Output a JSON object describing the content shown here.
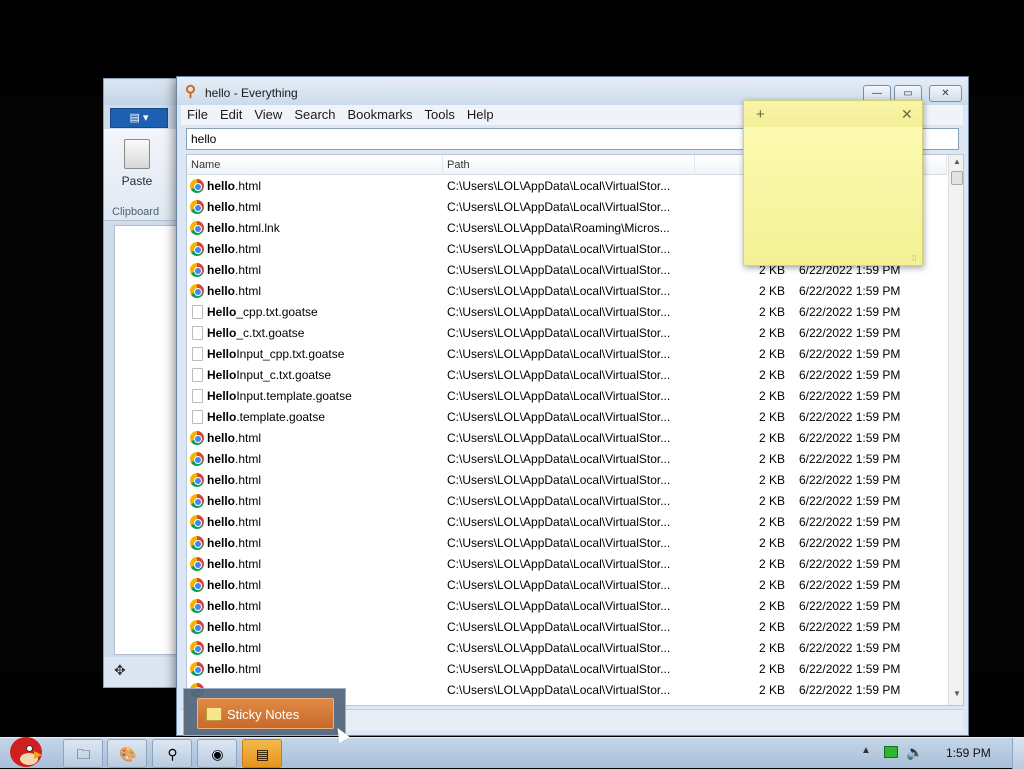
{
  "paint": {
    "tab_glyph": "▤ ▾",
    "paste_label": "Paste",
    "clipboard_label": "Clipboard",
    "move_glyph": "✥"
  },
  "everything": {
    "title": "hello - Everything",
    "app_icon_glyph": "⚲",
    "window_buttons": {
      "min": "—",
      "max": "▭",
      "close": "✕"
    },
    "menu": [
      "File",
      "Edit",
      "View",
      "Search",
      "Bookmarks",
      "Tools",
      "Help"
    ],
    "search_value": "hello",
    "columns": {
      "name": "Name",
      "path": "Path"
    },
    "rows": [
      {
        "bold": "hello",
        "rest": ".html",
        "icon": "chrome",
        "path": "C:\\Users\\LOL\\AppData\\Local\\VirtualStor...",
        "size": "",
        "date": ""
      },
      {
        "bold": "hello",
        "rest": ".html",
        "icon": "chrome",
        "path": "C:\\Users\\LOL\\AppData\\Local\\VirtualStor...",
        "size": "",
        "date": ""
      },
      {
        "bold": "hello",
        "rest": ".html.lnk",
        "icon": "chrome",
        "path": "C:\\Users\\LOL\\AppData\\Roaming\\Micros...",
        "size": "",
        "date": ""
      },
      {
        "bold": "hello",
        "rest": ".html",
        "icon": "chrome",
        "path": "C:\\Users\\LOL\\AppData\\Local\\VirtualStor...",
        "size": "",
        "date": ""
      },
      {
        "bold": "hello",
        "rest": ".html",
        "icon": "chrome",
        "path": "C:\\Users\\LOL\\AppData\\Local\\VirtualStor...",
        "size": "2 KB",
        "date": "6/22/2022 1:59 PM"
      },
      {
        "bold": "hello",
        "rest": ".html",
        "icon": "chrome",
        "path": "C:\\Users\\LOL\\AppData\\Local\\VirtualStor...",
        "size": "2 KB",
        "date": "6/22/2022 1:59 PM"
      },
      {
        "bold": "Hello",
        "rest": "_cpp.txt.goatse",
        "icon": "doc",
        "path": "C:\\Users\\LOL\\AppData\\Local\\VirtualStor...",
        "size": "2 KB",
        "date": "6/22/2022 1:59 PM"
      },
      {
        "bold": "Hello",
        "rest": "_c.txt.goatse",
        "icon": "doc",
        "path": "C:\\Users\\LOL\\AppData\\Local\\VirtualStor...",
        "size": "2 KB",
        "date": "6/22/2022 1:59 PM"
      },
      {
        "bold": "Hello",
        "rest": "Input_cpp.txt.goatse",
        "icon": "doc",
        "path": "C:\\Users\\LOL\\AppData\\Local\\VirtualStor...",
        "size": "2 KB",
        "date": "6/22/2022 1:59 PM"
      },
      {
        "bold": "Hello",
        "rest": "Input_c.txt.goatse",
        "icon": "doc",
        "path": "C:\\Users\\LOL\\AppData\\Local\\VirtualStor...",
        "size": "2 KB",
        "date": "6/22/2022 1:59 PM"
      },
      {
        "bold": "Hello",
        "rest": "Input.template.goatse",
        "icon": "doc",
        "path": "C:\\Users\\LOL\\AppData\\Local\\VirtualStor...",
        "size": "2 KB",
        "date": "6/22/2022 1:59 PM"
      },
      {
        "bold": "Hello",
        "rest": ".template.goatse",
        "icon": "doc",
        "path": "C:\\Users\\LOL\\AppData\\Local\\VirtualStor...",
        "size": "2 KB",
        "date": "6/22/2022 1:59 PM"
      },
      {
        "bold": "hello",
        "rest": ".html",
        "icon": "chrome",
        "path": "C:\\Users\\LOL\\AppData\\Local\\VirtualStor...",
        "size": "2 KB",
        "date": "6/22/2022 1:59 PM"
      },
      {
        "bold": "hello",
        "rest": ".html",
        "icon": "chrome",
        "path": "C:\\Users\\LOL\\AppData\\Local\\VirtualStor...",
        "size": "2 KB",
        "date": "6/22/2022 1:59 PM"
      },
      {
        "bold": "hello",
        "rest": ".html",
        "icon": "chrome",
        "path": "C:\\Users\\LOL\\AppData\\Local\\VirtualStor...",
        "size": "2 KB",
        "date": "6/22/2022 1:59 PM"
      },
      {
        "bold": "hello",
        "rest": ".html",
        "icon": "chrome",
        "path": "C:\\Users\\LOL\\AppData\\Local\\VirtualStor...",
        "size": "2 KB",
        "date": "6/22/2022 1:59 PM"
      },
      {
        "bold": "hello",
        "rest": ".html",
        "icon": "chrome",
        "path": "C:\\Users\\LOL\\AppData\\Local\\VirtualStor...",
        "size": "2 KB",
        "date": "6/22/2022 1:59 PM"
      },
      {
        "bold": "hello",
        "rest": ".html",
        "icon": "chrome",
        "path": "C:\\Users\\LOL\\AppData\\Local\\VirtualStor...",
        "size": "2 KB",
        "date": "6/22/2022 1:59 PM"
      },
      {
        "bold": "hello",
        "rest": ".html",
        "icon": "chrome",
        "path": "C:\\Users\\LOL\\AppData\\Local\\VirtualStor...",
        "size": "2 KB",
        "date": "6/22/2022 1:59 PM"
      },
      {
        "bold": "hello",
        "rest": ".html",
        "icon": "chrome",
        "path": "C:\\Users\\LOL\\AppData\\Local\\VirtualStor...",
        "size": "2 KB",
        "date": "6/22/2022 1:59 PM"
      },
      {
        "bold": "hello",
        "rest": ".html",
        "icon": "chrome",
        "path": "C:\\Users\\LOL\\AppData\\Local\\VirtualStor...",
        "size": "2 KB",
        "date": "6/22/2022 1:59 PM"
      },
      {
        "bold": "hello",
        "rest": ".html",
        "icon": "chrome",
        "path": "C:\\Users\\LOL\\AppData\\Local\\VirtualStor...",
        "size": "2 KB",
        "date": "6/22/2022 1:59 PM"
      },
      {
        "bold": "hello",
        "rest": ".html",
        "icon": "chrome",
        "path": "C:\\Users\\LOL\\AppData\\Local\\VirtualStor...",
        "size": "2 KB",
        "date": "6/22/2022 1:59 PM"
      },
      {
        "bold": "hello",
        "rest": ".html",
        "icon": "chrome",
        "path": "C:\\Users\\LOL\\AppData\\Local\\VirtualStor...",
        "size": "2 KB",
        "date": "6/22/2022 1:59 PM"
      },
      {
        "bold": "",
        "rest": "",
        "icon": "chrome",
        "path": "C:\\Users\\LOL\\AppData\\Local\\VirtualStor...",
        "size": "2 KB",
        "date": "6/22/2022 1:59 PM"
      }
    ]
  },
  "sticky": {
    "add_glyph": "+",
    "close_glyph": "✕",
    "grip_glyph": "⁞⁞"
  },
  "taskbar": {
    "thumbnail_label": "Sticky Notes",
    "buttons": [
      {
        "name": "explorer-button",
        "icon": "folder-icon",
        "glyph": "🗀"
      },
      {
        "name": "paint-button",
        "icon": "paint-icon",
        "glyph": "🎨"
      },
      {
        "name": "everything-button",
        "icon": "everything-search-icon",
        "glyph": "⚲"
      },
      {
        "name": "chrome-button",
        "icon": "chrome-icon",
        "glyph": "◉"
      },
      {
        "name": "sticky-notes-button",
        "icon": "sticky-notes-icon",
        "glyph": "▤"
      }
    ],
    "tray_up": "▲",
    "tray_volume": "🔈",
    "clock": "1:59 PM"
  }
}
